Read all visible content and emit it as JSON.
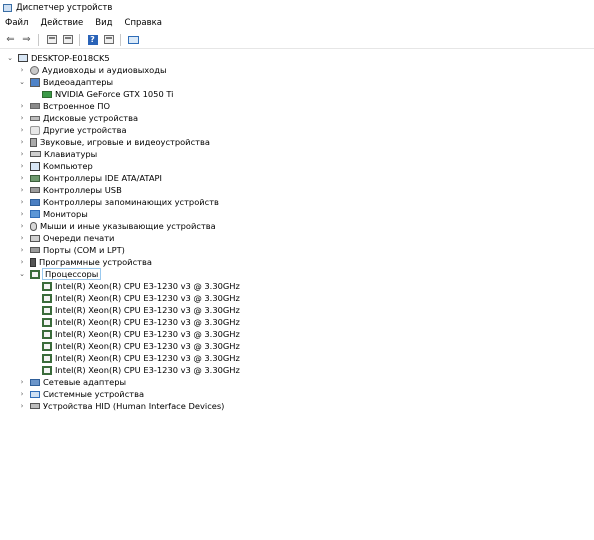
{
  "window": {
    "title": "Диспетчер устройств"
  },
  "menu": [
    "Файл",
    "Действие",
    "Вид",
    "Справка"
  ],
  "toolbar": {
    "buttons": [
      "back-arrow-icon",
      "forward-arrow-icon",
      "properties-icon",
      "update-driver-icon",
      "help-icon",
      "monitor-icon"
    ]
  },
  "tree": {
    "root": "DESKTOP-E018CK5",
    "categories": [
      "Аудиовходы и аудиовыходы",
      "Видеоадаптеры",
      "Встроенное ПО",
      "Дисковые устройства",
      "Другие устройства",
      "Звуковые, игровые и видеоустройства",
      "Клавиатуры",
      "Компьютер",
      "Контроллеры IDE ATA/ATAPI",
      "Контроллеры USB",
      "Контроллеры запоминающих устройств",
      "Мониторы",
      "Мыши и иные указывающие устройства",
      "Очереди печати",
      "Порты (COM и LPT)",
      "Программные устройства",
      "Процессоры",
      "Сетевые адаптеры",
      "Системные устройства",
      "Устройства HID (Human Interface Devices)"
    ],
    "video_adapter": "NVIDIA GeForce GTX 1050 Ti",
    "processors": [
      "Intel(R) Xeon(R) CPU E3-1230 v3 @ 3.30GHz",
      "Intel(R) Xeon(R) CPU E3-1230 v3 @ 3.30GHz",
      "Intel(R) Xeon(R) CPU E3-1230 v3 @ 3.30GHz",
      "Intel(R) Xeon(R) CPU E3-1230 v3 @ 3.30GHz",
      "Intel(R) Xeon(R) CPU E3-1230 v3 @ 3.30GHz",
      "Intel(R) Xeon(R) CPU E3-1230 v3 @ 3.30GHz",
      "Intel(R) Xeon(R) CPU E3-1230 v3 @ 3.30GHz",
      "Intel(R) Xeon(R) CPU E3-1230 v3 @ 3.30GHz"
    ]
  },
  "colors": {
    "selection_outline": "#99c9ef",
    "cpu_icon": "#3a6b3a"
  }
}
